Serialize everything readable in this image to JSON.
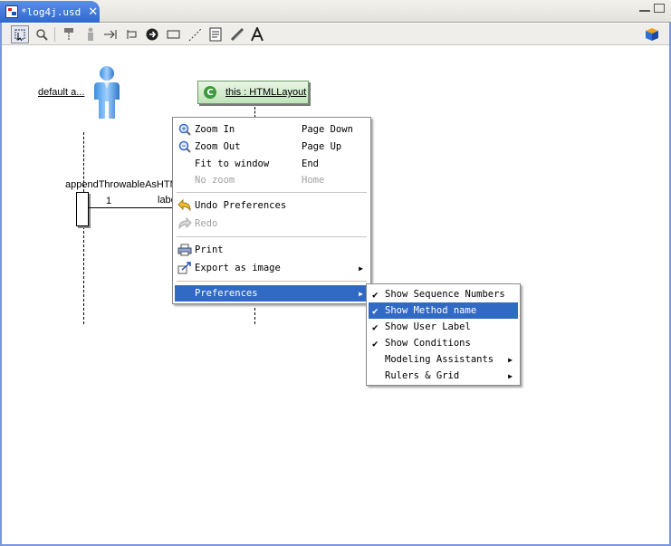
{
  "editor": {
    "tab_title": "*log4j.usd",
    "close_symbol": "✕"
  },
  "toolbar": {
    "tools": [
      "select",
      "zoom",
      "lifeline",
      "message",
      "return",
      "self-message",
      "create",
      "object",
      "note-connector",
      "note",
      "link",
      "text"
    ]
  },
  "diagram": {
    "actor_label": "default a...",
    "object_label": "this : HTMLLayout",
    "message_label": "appendThrowableAsHTM",
    "sequence_number": "1",
    "partial_label": "labe"
  },
  "context_menu": {
    "items": [
      {
        "label": "Zoom In",
        "accel": "Page Down",
        "icon": "zoom-in-icon"
      },
      {
        "label": "Zoom Out",
        "accel": "Page Up",
        "icon": "zoom-out-icon"
      },
      {
        "label": "Fit to window",
        "accel": "End"
      },
      {
        "label": "No zoom",
        "accel": "Home",
        "disabled": true
      },
      {
        "label": "Undo Preferences",
        "icon": "undo-icon"
      },
      {
        "label": "Redo",
        "icon": "redo-icon",
        "disabled": true
      },
      {
        "label": "Print",
        "icon": "print-icon"
      },
      {
        "label": "Export as image",
        "icon": "export-icon"
      },
      {
        "label": "Preferences"
      }
    ]
  },
  "preferences_submenu": {
    "items": [
      {
        "label": "Show Sequence Numbers",
        "checked": true
      },
      {
        "label": "Show Method name",
        "checked": true
      },
      {
        "label": "Show User Label",
        "checked": true
      },
      {
        "label": "Show Conditions",
        "checked": true
      },
      {
        "label": "Modeling Assistants"
      },
      {
        "label": "Rulers & Grid"
      }
    ]
  },
  "colors": {
    "highlight": "#316ac5",
    "tab": "#3a74d8",
    "object_fill": "#cfe9c9"
  }
}
